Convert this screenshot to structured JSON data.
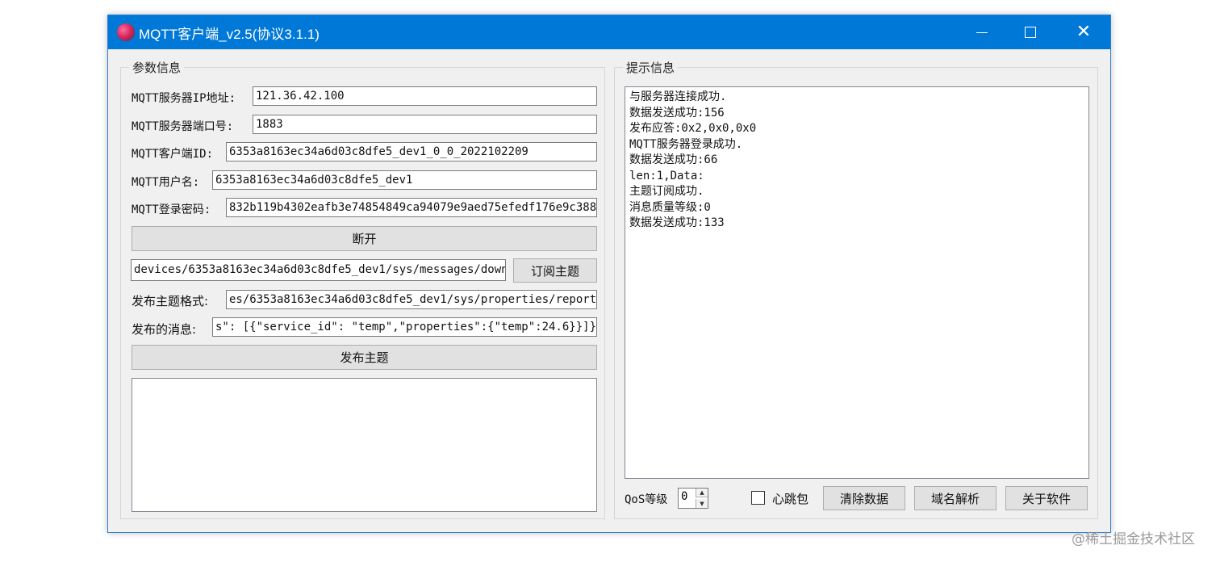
{
  "window": {
    "title": "MQTT客户端_v2.5(协议3.1.1)",
    "icons": {
      "minimize": "minimize-icon",
      "maximize": "maximize-icon",
      "close": "close-icon"
    }
  },
  "params": {
    "group_title": "参数信息",
    "server_ip_label": "MQTT服务器IP地址:",
    "server_ip_value": "121.36.42.100",
    "server_port_label": "MQTT服务器端口号:",
    "server_port_value": "1883",
    "client_id_label": "MQTT客户端ID:",
    "client_id_value": "6353a8163ec34a6d03c8dfe5_dev1_0_0_2022102209",
    "username_label": "MQTT用户名:",
    "username_value": "6353a8163ec34a6d03c8dfe5_dev1",
    "password_label": "MQTT登录密码:",
    "password_value": "832b119b4302eafb3e74854849ca94079e9aed75efedf176e9c388",
    "disconnect_button": "断开",
    "subscribe_topic_value": "devices/6353a8163ec34a6d03c8dfe5_dev1/sys/messages/down",
    "subscribe_button": "订阅主题",
    "publish_topic_label": "发布主题格式:",
    "publish_topic_value": "es/6353a8163ec34a6d03c8dfe5_dev1/sys/properties/report",
    "publish_message_label": "发布的消息:",
    "publish_message_value": "s\": [{\"service_id\": \"temp\",\"properties\":{\"temp\":24.6}}]}",
    "publish_button": "发布主题",
    "message_area_value": ""
  },
  "info": {
    "group_title": "提示信息",
    "log_lines": [
      "与服务器连接成功.",
      "数据发送成功:156",
      "发布应答:0x2,0x0,0x0",
      "MQTT服务器登录成功.",
      "数据发送成功:66",
      "len:1,Data:",
      "主题订阅成功.",
      "消息质量等级:0",
      "数据发送成功:133"
    ],
    "qos_label": "QoS等级",
    "qos_value": "0",
    "heartbeat_label": "心跳包",
    "heartbeat_checked": false,
    "clear_button": "清除数据",
    "dns_button": "域名解析",
    "about_button": "关于软件"
  },
  "watermark": "@稀土掘金技术社区",
  "colors": {
    "titlebar": "#0078d7",
    "window_bg": "#f0f0f0",
    "button_bg": "#e1e1e1"
  }
}
